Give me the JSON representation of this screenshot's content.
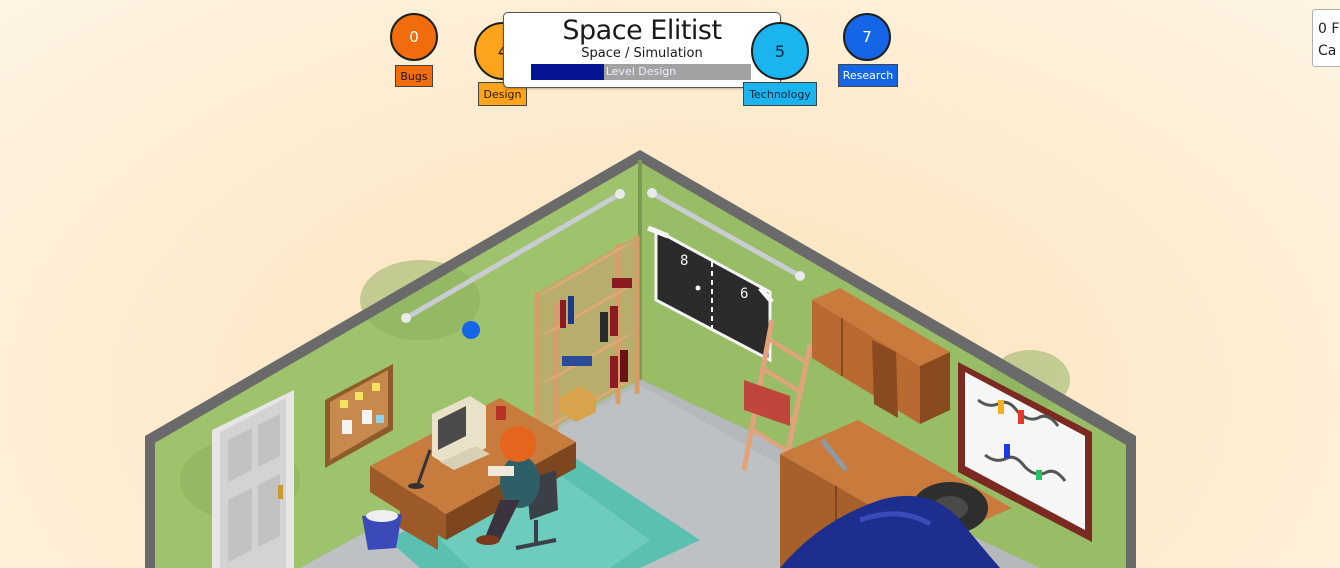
{
  "hud": {
    "bugs": {
      "value": "0",
      "label": "Bugs",
      "color": "#f06c0c"
    },
    "design": {
      "value": "4",
      "label": "Design",
      "color": "#fba41c"
    },
    "technology": {
      "value": "5",
      "label": "Technology",
      "color": "#1ab4ee"
    },
    "research": {
      "value": "7",
      "label": "Research",
      "color": "#1466e6"
    }
  },
  "game": {
    "title": "Space Elitist",
    "genre": "Space / Simulation",
    "phase": "Level Design",
    "progress": 0.33
  },
  "status": {
    "fans_line": "0 F",
    "cash_line": "Ca"
  },
  "wall_screen": {
    "left_score": "8",
    "right_score": "6"
  },
  "colors": {
    "wall": "#9ec36c",
    "floor": "#b5b9bc",
    "rug": "#5cc0b0",
    "wood": "#b56a34",
    "hair": "#e5651c",
    "tarp": "#1e2e8e"
  }
}
